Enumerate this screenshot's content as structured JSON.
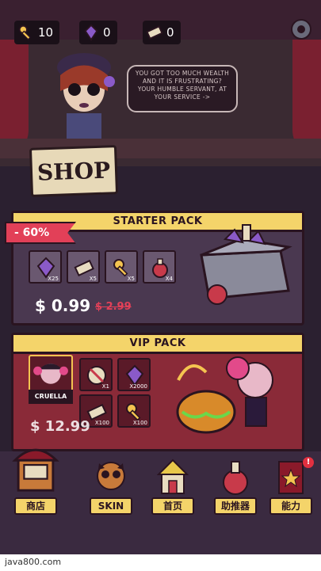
{
  "resources": {
    "keys": "10",
    "gems": "0",
    "tickets": "0"
  },
  "npc_speech": "YOU GOT TOO MUCH WEALTH AND IT IS FRUSTRATING? YOUR HUMBLE SERVANT, AT YOUR SERVICE ->",
  "shop_sign": "SHOP",
  "starter_pack": {
    "title": "STARTER PACK",
    "discount": "- 60%",
    "items": [
      {
        "icon": "gem-icon",
        "qty": "X25"
      },
      {
        "icon": "ticket-icon",
        "qty": "X5"
      },
      {
        "icon": "key-icon",
        "qty": "X5"
      },
      {
        "icon": "potion-icon",
        "qty": "X4"
      }
    ],
    "price": "$ 0.99",
    "old_price": "$ 2.99"
  },
  "vip_pack": {
    "title": "VIP PACK",
    "character": "CRUELLA",
    "items": [
      {
        "icon": "no-ads-icon",
        "qty": "X1"
      },
      {
        "icon": "gem-icon",
        "qty": "X2000"
      },
      {
        "icon": "ticket-icon",
        "qty": "X100"
      },
      {
        "icon": "key-icon",
        "qty": "X100"
      }
    ],
    "price": "$ 12.99"
  },
  "nav": [
    {
      "label": "商店",
      "icon": "shop-stall-icon"
    },
    {
      "label": "SKIN",
      "icon": "owl-icon"
    },
    {
      "label": "首页",
      "icon": "house-icon"
    },
    {
      "label": "助推器",
      "icon": "potion-icon"
    },
    {
      "label": "能力",
      "icon": "book-icon",
      "badge": "!"
    }
  ],
  "watermark": "java800.com",
  "colors": {
    "accent_yellow": "#f4d46a",
    "discount_red": "#e24058",
    "vip_red": "#8a2a38",
    "panel_purple": "#4a3850"
  }
}
